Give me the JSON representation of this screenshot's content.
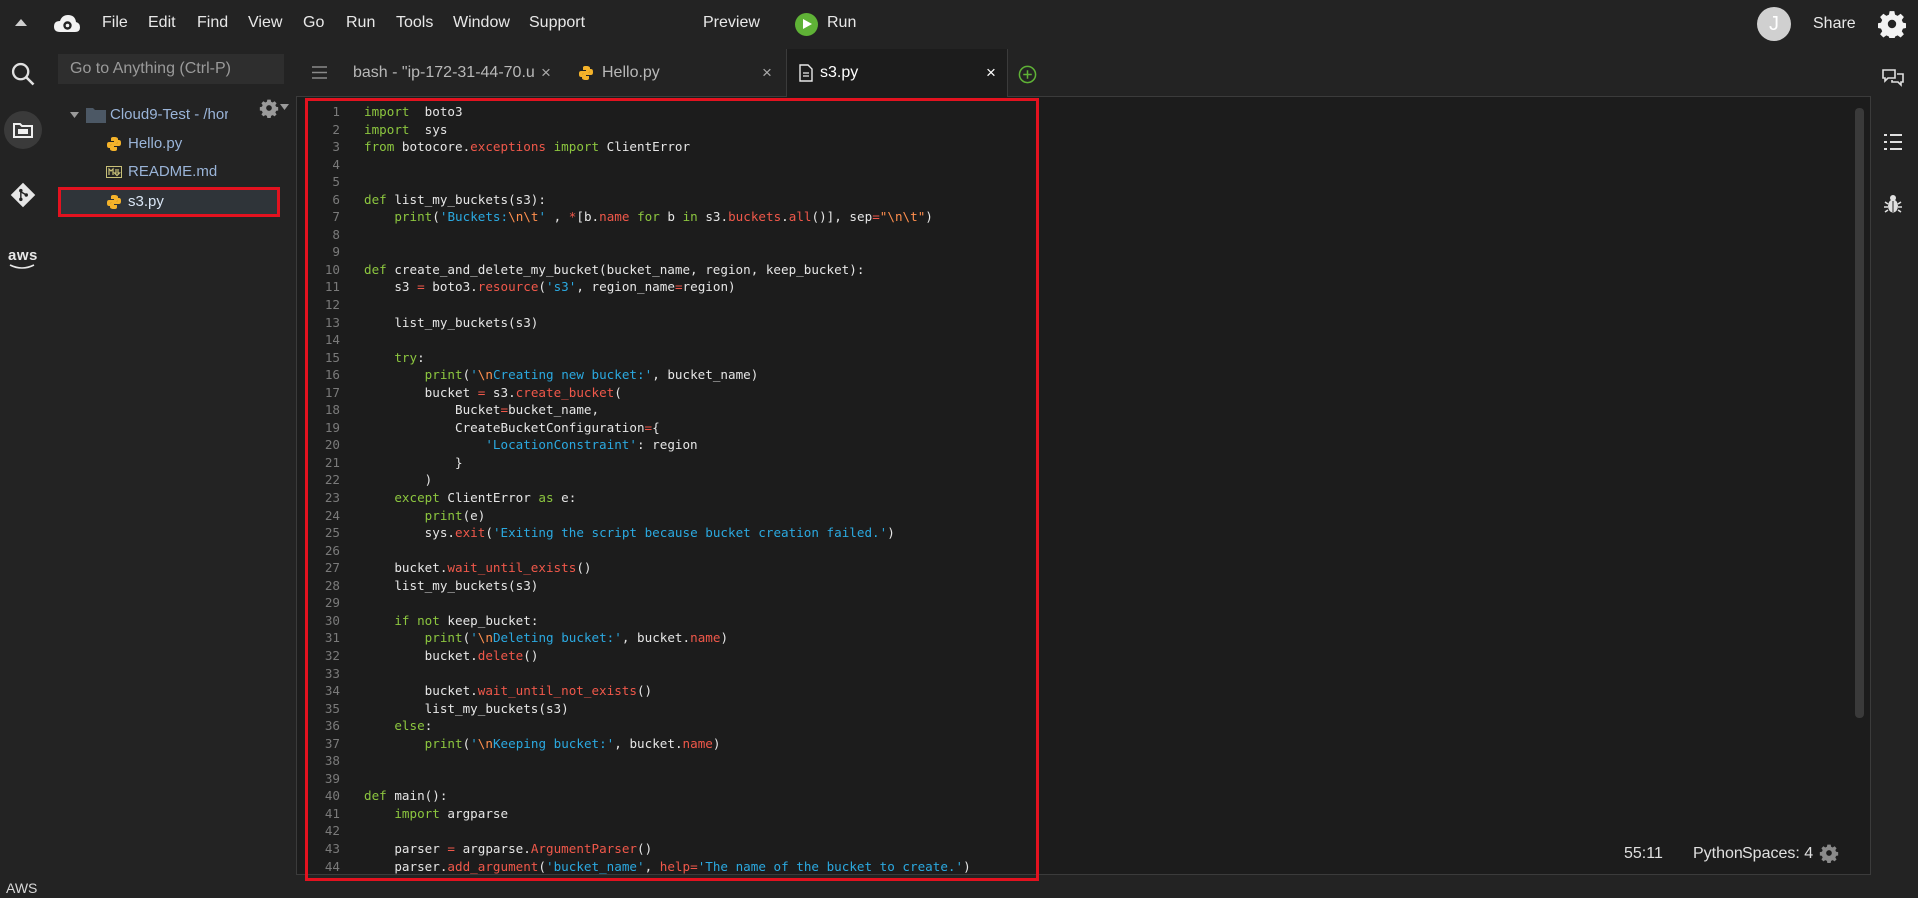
{
  "menu": {
    "items": [
      "File",
      "Edit",
      "Find",
      "View",
      "Go",
      "Run",
      "Tools",
      "Window",
      "Support"
    ],
    "preview": "Preview",
    "run": "Run",
    "share": "Share",
    "avatar_letter": "J"
  },
  "sidebar": {
    "goto_placeholder": "Go to Anything (Ctrl-P)",
    "root_folder": "Cloud9-Test - /hor",
    "files": [
      "Hello.py",
      "README.md",
      "s3.py"
    ],
    "selected_file": "s3.py"
  },
  "rail": {
    "aws_logo_text": "aws",
    "bottom_label": "AWS"
  },
  "tabs": [
    {
      "label": "bash - \"ip-172-31-44-70.u"
    },
    {
      "label": "Hello.py"
    },
    {
      "label": "s3.py",
      "active": true
    }
  ],
  "editor": {
    "start_line": 1,
    "lines": [
      [
        [
          "k",
          "import"
        ],
        [
          "",
          "  boto3"
        ]
      ],
      [
        [
          "k",
          "import"
        ],
        [
          "",
          "  sys"
        ]
      ],
      [
        [
          "k",
          "from"
        ],
        [
          "",
          " botocore."
        ],
        [
          "r",
          "exceptions"
        ],
        [
          "",
          " "
        ],
        [
          "k",
          "import"
        ],
        [
          "",
          " ClientError"
        ]
      ],
      [],
      [],
      [
        [
          "k",
          "def"
        ],
        [
          "",
          " list_my_buckets(s3):"
        ]
      ],
      [
        [
          "",
          "    "
        ],
        [
          "k",
          "print"
        ],
        [
          "",
          "("
        ],
        [
          "s",
          "'Buckets:"
        ],
        [
          "o",
          "\\n\\t"
        ],
        [
          "s",
          "'"
        ],
        [
          "",
          " , "
        ],
        [
          "r",
          "*"
        ],
        [
          "",
          "[b."
        ],
        [
          "r",
          "name"
        ],
        [
          "",
          " "
        ],
        [
          "k",
          "for"
        ],
        [
          "",
          " b "
        ],
        [
          "k",
          "in"
        ],
        [
          "",
          " s3."
        ],
        [
          "r",
          "buckets"
        ],
        [
          "",
          "."
        ],
        [
          "r",
          "all"
        ],
        [
          "",
          "()], sep"
        ],
        [
          "r",
          "="
        ],
        [
          "o",
          "\"\\n\\t\""
        ],
        [
          "",
          ")"
        ]
      ],
      [],
      [],
      [
        [
          "k",
          "def"
        ],
        [
          "",
          " create_and_delete_my_bucket(bucket_name, region, keep_bucket):"
        ]
      ],
      [
        [
          "",
          "    s3 "
        ],
        [
          "r",
          "="
        ],
        [
          "",
          " boto3."
        ],
        [
          "r",
          "resource"
        ],
        [
          "",
          "("
        ],
        [
          "s",
          "'s3'"
        ],
        [
          "",
          ", region_name"
        ],
        [
          "r",
          "="
        ],
        [
          "",
          "region)"
        ]
      ],
      [],
      [
        [
          "",
          "    list_my_buckets(s3)"
        ]
      ],
      [],
      [
        [
          "",
          "    "
        ],
        [
          "k",
          "try"
        ],
        [
          "",
          ":"
        ]
      ],
      [
        [
          "",
          "        "
        ],
        [
          "k",
          "print"
        ],
        [
          "",
          "("
        ],
        [
          "s",
          "'"
        ],
        [
          "o",
          "\\n"
        ],
        [
          "s",
          "Creating new bucket:'"
        ],
        [
          "",
          ", bucket_name)"
        ]
      ],
      [
        [
          "",
          "        bucket "
        ],
        [
          "r",
          "="
        ],
        [
          "",
          " s3."
        ],
        [
          "r",
          "create_bucket"
        ],
        [
          "",
          "("
        ]
      ],
      [
        [
          "",
          "            Bucket"
        ],
        [
          "r",
          "="
        ],
        [
          "",
          "bucket_name,"
        ]
      ],
      [
        [
          "",
          "            CreateBucketConfiguration"
        ],
        [
          "r",
          "="
        ],
        [
          "",
          "{"
        ]
      ],
      [
        [
          "",
          "                "
        ],
        [
          "s",
          "'LocationConstraint'"
        ],
        [
          "",
          ": region"
        ]
      ],
      [
        [
          "",
          "            }"
        ]
      ],
      [
        [
          "",
          "        )"
        ]
      ],
      [
        [
          "",
          "    "
        ],
        [
          "k",
          "except"
        ],
        [
          "",
          " ClientError "
        ],
        [
          "k",
          "as"
        ],
        [
          "",
          " e:"
        ]
      ],
      [
        [
          "",
          "        "
        ],
        [
          "k",
          "print"
        ],
        [
          "",
          "(e)"
        ]
      ],
      [
        [
          "",
          "        sys."
        ],
        [
          "r",
          "exit"
        ],
        [
          "",
          "("
        ],
        [
          "s",
          "'Exiting the script because bucket creation failed.'"
        ],
        [
          "",
          ")"
        ]
      ],
      [],
      [
        [
          "",
          "    bucket."
        ],
        [
          "r",
          "wait_until_exists"
        ],
        [
          "",
          "()"
        ]
      ],
      [
        [
          "",
          "    list_my_buckets(s3)"
        ]
      ],
      [],
      [
        [
          "",
          "    "
        ],
        [
          "k",
          "if not"
        ],
        [
          "",
          " keep_bucket:"
        ]
      ],
      [
        [
          "",
          "        "
        ],
        [
          "k",
          "print"
        ],
        [
          "",
          "("
        ],
        [
          "s",
          "'"
        ],
        [
          "o",
          "\\n"
        ],
        [
          "s",
          "Deleting bucket:'"
        ],
        [
          "",
          ", bucket."
        ],
        [
          "r",
          "name"
        ],
        [
          "",
          ")"
        ]
      ],
      [
        [
          "",
          "        bucket."
        ],
        [
          "r",
          "delete"
        ],
        [
          "",
          "()"
        ]
      ],
      [],
      [
        [
          "",
          "        bucket."
        ],
        [
          "r",
          "wait_until_not_exists"
        ],
        [
          "",
          "()"
        ]
      ],
      [
        [
          "",
          "        list_my_buckets(s3)"
        ]
      ],
      [
        [
          "",
          "    "
        ],
        [
          "k",
          "else"
        ],
        [
          "",
          ":"
        ]
      ],
      [
        [
          "",
          "        "
        ],
        [
          "k",
          "print"
        ],
        [
          "",
          "("
        ],
        [
          "s",
          "'"
        ],
        [
          "o",
          "\\n"
        ],
        [
          "s",
          "Keeping bucket:'"
        ],
        [
          "",
          ", bucket."
        ],
        [
          "r",
          "name"
        ],
        [
          "",
          ")"
        ]
      ],
      [],
      [],
      [
        [
          "k",
          "def"
        ],
        [
          "",
          " main():"
        ]
      ],
      [
        [
          "",
          "    "
        ],
        [
          "k",
          "import"
        ],
        [
          "",
          " argparse"
        ]
      ],
      [],
      [
        [
          "",
          "    parser "
        ],
        [
          "r",
          "="
        ],
        [
          "",
          " argparse."
        ],
        [
          "r",
          "ArgumentParser"
        ],
        [
          "",
          "()"
        ]
      ],
      [
        [
          "",
          "    parser."
        ],
        [
          "r",
          "add_argument"
        ],
        [
          "",
          "("
        ],
        [
          "s",
          "'bucket_name'"
        ],
        [
          "",
          ", "
        ],
        [
          "r",
          "help"
        ],
        [
          "r",
          "="
        ],
        [
          "s",
          "'The name of the bucket to create.'"
        ],
        [
          "",
          ")"
        ]
      ]
    ]
  },
  "status": {
    "position": "55:11",
    "language": "Python",
    "indent": "Spaces: 4"
  },
  "colors": {
    "highlight_border": "#e3121f",
    "keyword": "#8cc63f",
    "string": "#2ba9e0",
    "builtin": "#f0584a",
    "run_green": "#5fb236"
  }
}
